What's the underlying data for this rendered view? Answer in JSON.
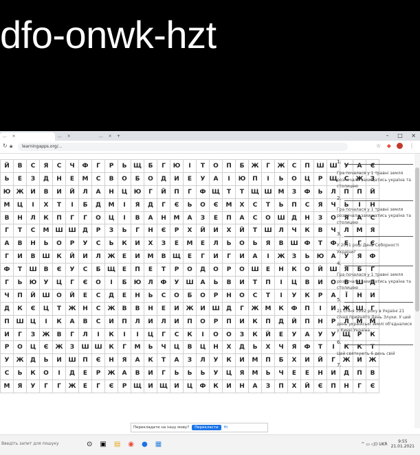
{
  "meet_code": "dfo-onwk-hzt",
  "browser": {
    "tabs": [
      {
        "label": "...",
        "close": "×"
      },
      {
        "label": "...",
        "close": "×"
      },
      {
        "label": "...",
        "close": "×"
      }
    ],
    "new_tab": "+",
    "window_controls": {
      "minimize": "–",
      "maximize": "□",
      "close": "×"
    },
    "url": "learningapps.org/...",
    "ext_icons": {
      "star": "☆",
      "ext": "◆",
      "profile": "",
      "menu": "⋮"
    }
  },
  "grid_rows": [
    [
      "Й",
      "В",
      "С",
      "Я",
      "С",
      "Ч",
      "Ф",
      "Г",
      "Р",
      "Ь",
      "Щ",
      "Б",
      "Г",
      "Ю",
      "І",
      "Т",
      "О",
      "П",
      "Б",
      "Ж",
      "Г",
      "Ж",
      "С",
      "П",
      "Ш",
      "Ш",
      "У",
      "А",
      "Є"
    ],
    [
      "Ь",
      "Е",
      "З",
      "Д",
      "Н",
      "Е",
      "М",
      "С",
      "В",
      "О",
      "Б",
      "О",
      "Д",
      "И",
      "Е",
      "У",
      "А",
      "І",
      "Ю",
      "П",
      "І",
      "Ь",
      "О",
      "Ц",
      "Р",
      "Щ",
      "С",
      "Ж",
      "З"
    ],
    [
      "Ю",
      "Ж",
      "И",
      "В",
      "И",
      "Й",
      "Л",
      "А",
      "Н",
      "Ц",
      "Ю",
      "Г",
      "Й",
      "П",
      "Г",
      "Ф",
      "Щ",
      "Т",
      "Т",
      "Щ",
      "Ш",
      "М",
      "З",
      "Ф",
      "Ь",
      "Л",
      "П",
      "П",
      "Й"
    ],
    [
      "М",
      "Ц",
      "І",
      "Х",
      "Т",
      "І",
      "Б",
      "Д",
      "М",
      "І",
      "Я",
      "Д",
      "Г",
      "Є",
      "Ь",
      "О",
      "Є",
      "М",
      "Х",
      "С",
      "Т",
      "Ь",
      "П",
      "С",
      "Я",
      "Ч",
      "Ь",
      "І",
      "Н"
    ],
    [
      "В",
      "Н",
      "Л",
      "К",
      "П",
      "Г",
      "Г",
      "О",
      "Ц",
      "І",
      "В",
      "А",
      "Н",
      "М",
      "А",
      "З",
      "Е",
      "П",
      "А",
      "С",
      "О",
      "Ш",
      "Д",
      "Н",
      "З",
      "О",
      "Я",
      "А",
      "С"
    ],
    [
      "Г",
      "Т",
      "С",
      "М",
      "Ш",
      "Ш",
      "Д",
      "Р",
      "З",
      "Ь",
      "Г",
      "Н",
      "Є",
      "Р",
      "Х",
      "Й",
      "И",
      "Х",
      "Й",
      "Т",
      "Ш",
      "Л",
      "Ч",
      "К",
      "В",
      "Ч",
      "Л",
      "М",
      "Я"
    ],
    [
      "А",
      "В",
      "Н",
      "Ь",
      "О",
      "Р",
      "У",
      "С",
      "Ь",
      "К",
      "И",
      "Х",
      "З",
      "Е",
      "М",
      "Е",
      "Л",
      "Ь",
      "О",
      "Ь",
      "Я",
      "В",
      "Ш",
      "Ф",
      "Т",
      "Ф",
      "Е",
      "Г",
      "Є"
    ],
    [
      "Г",
      "И",
      "В",
      "Ш",
      "К",
      "Й",
      "И",
      "Л",
      "Ж",
      "Е",
      "И",
      "М",
      "В",
      "Щ",
      "Е",
      "Г",
      "И",
      "Г",
      "И",
      "А",
      "І",
      "Ж",
      "З",
      "Ь",
      "Ю",
      "А",
      "У",
      "Я",
      "Ф"
    ],
    [
      "Ф",
      "Т",
      "Ш",
      "В",
      "Є",
      "У",
      "С",
      "Б",
      "Щ",
      "Е",
      "П",
      "Е",
      "Т",
      "Р",
      "О",
      "Д",
      "О",
      "Р",
      "О",
      "Ш",
      "Е",
      "Н",
      "К",
      "О",
      "Й",
      "Ш",
      "Я",
      "Б",
      "Ґ"
    ],
    [
      "Г",
      "Ь",
      "Ю",
      "У",
      "Ц",
      "Г",
      "Є",
      "О",
      "І",
      "Б",
      "Ю",
      "Л",
      "Ф",
      "У",
      "Ш",
      "А",
      "Ь",
      "В",
      "И",
      "Т",
      "П",
      "І",
      "Ц",
      "В",
      "И",
      "О",
      "В",
      "Ш",
      "Д"
    ],
    [
      "Ч",
      "П",
      "Й",
      "Ш",
      "О",
      "Й",
      "Е",
      "С",
      "Д",
      "Е",
      "Н",
      "Ь",
      "С",
      "О",
      "Б",
      "О",
      "Р",
      "Н",
      "О",
      "С",
      "Т",
      "І",
      "У",
      "К",
      "Р",
      "А",
      "Ї",
      "Н",
      "И"
    ],
    [
      "Д",
      "К",
      "Є",
      "Ц",
      "Т",
      "Ж",
      "Н",
      "С",
      "Ж",
      "В",
      "В",
      "Н",
      "Е",
      "И",
      "Ж",
      "И",
      "Ш",
      "Д",
      "Г",
      "Ж",
      "М",
      "К",
      "Ф",
      "П",
      "І",
      "И",
      "Ж",
      "Ш",
      "Г"
    ],
    [
      "П",
      "Ш",
      "Ц",
      "І",
      "К",
      "А",
      "В",
      "С",
      "И",
      "П",
      "Л",
      "И",
      "Л",
      "И",
      "П",
      "О",
      "Р",
      "П",
      "И",
      "К",
      "П",
      "Д",
      "Й",
      "П",
      "Н",
      "Р",
      "Л",
      "М",
      "М"
    ],
    [
      "И",
      "Г",
      "З",
      "Ж",
      "В",
      "Г",
      "Л",
      "І",
      "К",
      "І",
      "І",
      "Ц",
      "Г",
      "С",
      "К",
      "І",
      "О",
      "О",
      "З",
      "К",
      "Й",
      "Е",
      "У",
      "А",
      "У",
      "У",
      "Щ",
      "Р",
      "К"
    ],
    [
      "Р",
      "О",
      "Ц",
      "Є",
      "Ж",
      "З",
      "Ш",
      "Ш",
      "К",
      "Г",
      "М",
      "Ь",
      "Ч",
      "Ц",
      "В",
      "Ц",
      "Н",
      "Х",
      "Д",
      "Ь",
      "Х",
      "Ч",
      "Я",
      "Ф",
      "Т",
      "І",
      "К",
      "К",
      "Т"
    ],
    [
      "У",
      "Ж",
      "Д",
      "Ь",
      "И",
      "Ш",
      "П",
      "Є",
      "Н",
      "Я",
      "А",
      "К",
      "Т",
      "А",
      "З",
      "Л",
      "У",
      "К",
      "И",
      "М",
      "П",
      "Б",
      "Х",
      "И",
      "Й",
      "Г",
      "Ж",
      "И",
      "Ж"
    ],
    [
      "С",
      "Ь",
      "К",
      "О",
      "І",
      "Д",
      "Е",
      "Р",
      "Ж",
      "А",
      "В",
      "И",
      "Г",
      "Ь",
      "Ь",
      "Ь",
      "У",
      "Ц",
      "Я",
      "М",
      "Ь",
      "Ч",
      "Е",
      "Е",
      "Н",
      "И",
      "Д",
      "П",
      "В"
    ],
    [
      "М",
      "Я",
      "У",
      "Г",
      "Г",
      "Ж",
      "Е",
      "Г",
      "Є",
      "Р",
      "Щ",
      "И",
      "Щ",
      "И",
      "Ц",
      "Ф",
      "К",
      "И",
      "Н",
      "А",
      "З",
      "П",
      "Х",
      "Й",
      "Є",
      "П",
      "Н",
      "Г",
      "Є"
    ]
  ],
  "questions": [
    {
      "num": "1.",
      "text": "Гра почалася у 1 травні земля розпочали захищатись україна та столицею"
    },
    {
      "num": "2.",
      "text": "Гра почалася у 1 травні земля розпочали захищатись україна та столицею"
    },
    {
      "num": "3.",
      "text": "У 2011 році День Соборності України?"
    },
    {
      "num": "4.",
      "text": "Гра почалася у 1 травні земля розпочали захищатись україна та столицею"
    },
    {
      "num": "5.",
      "text": "21 січня 1992 року в Україні 21 січня прийнято День Злуки. У цей день українські землі об'єдналися у Києві Україна"
    },
    {
      "num": "6.",
      "text": "Цей святкують 6 день свій"
    },
    {
      "num": "7.",
      "text": ""
    }
  ],
  "translate_bar": {
    "text": "Перекладати на іншу мову?",
    "button": "Перекласти",
    "link": "Ні"
  },
  "taskbar": {
    "search": "Введіть запит для пошуку",
    "apps": [
      "⊙",
      "▣",
      "▤",
      "◉",
      "●",
      "▦"
    ],
    "tray": "^ ▭ ◁)) UKR",
    "time": "9:55",
    "date": "21.01.2021"
  }
}
